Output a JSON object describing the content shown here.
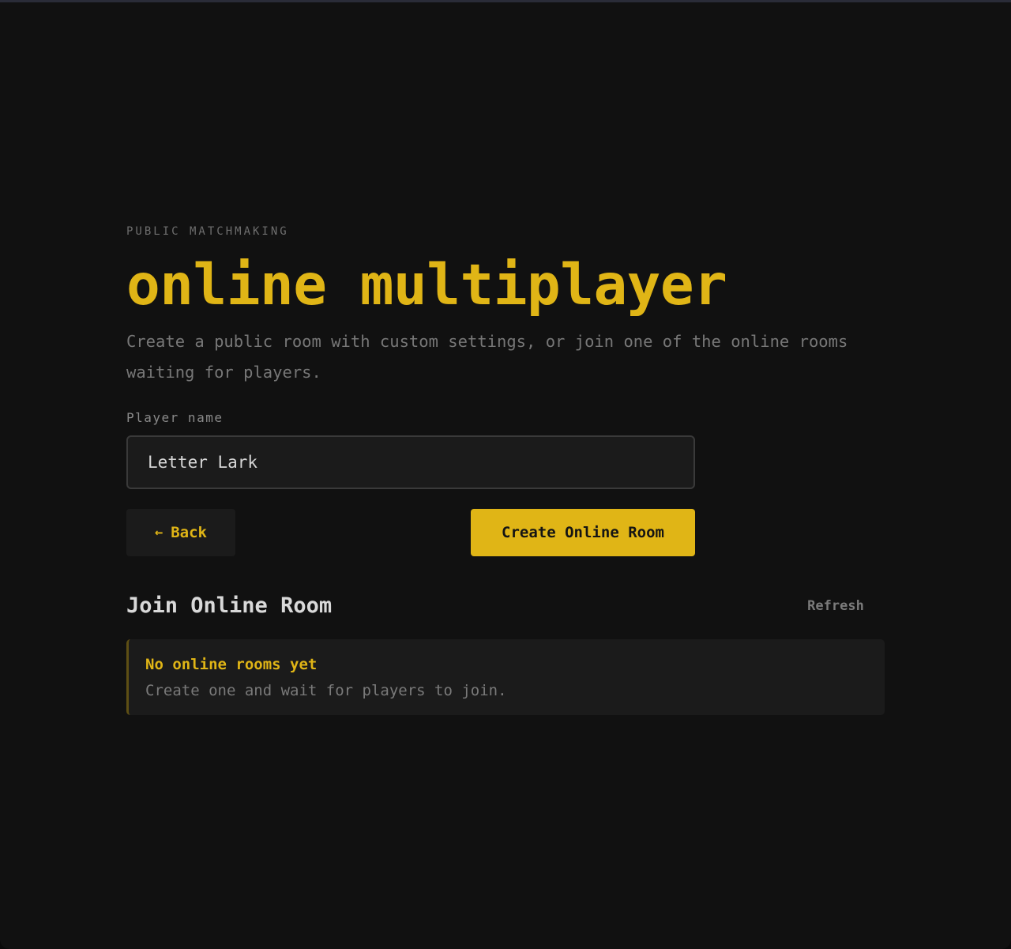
{
  "colors": {
    "accent": "#e0b516",
    "background": "#111111",
    "surface": "#1b1b1b",
    "text_primary": "#d9d9d9",
    "text_muted": "#777777"
  },
  "header": {
    "eyebrow": "PUBLIC MATCHMAKING",
    "title": "online multiplayer",
    "subtitle": "Create a public room with custom settings, or join one of the online rooms waiting for players."
  },
  "form": {
    "player_name_label": "Player name",
    "player_name_value": "Letter Lark"
  },
  "actions": {
    "back_icon": "arrow-left-icon",
    "back_arrow": "←",
    "back_label": "Back",
    "create_label": "Create Online Room"
  },
  "rooms": {
    "section_title": "Join Online Room",
    "refresh_label": "Refresh",
    "empty_title": "No online rooms yet",
    "empty_description": "Create one and wait for players to join."
  }
}
